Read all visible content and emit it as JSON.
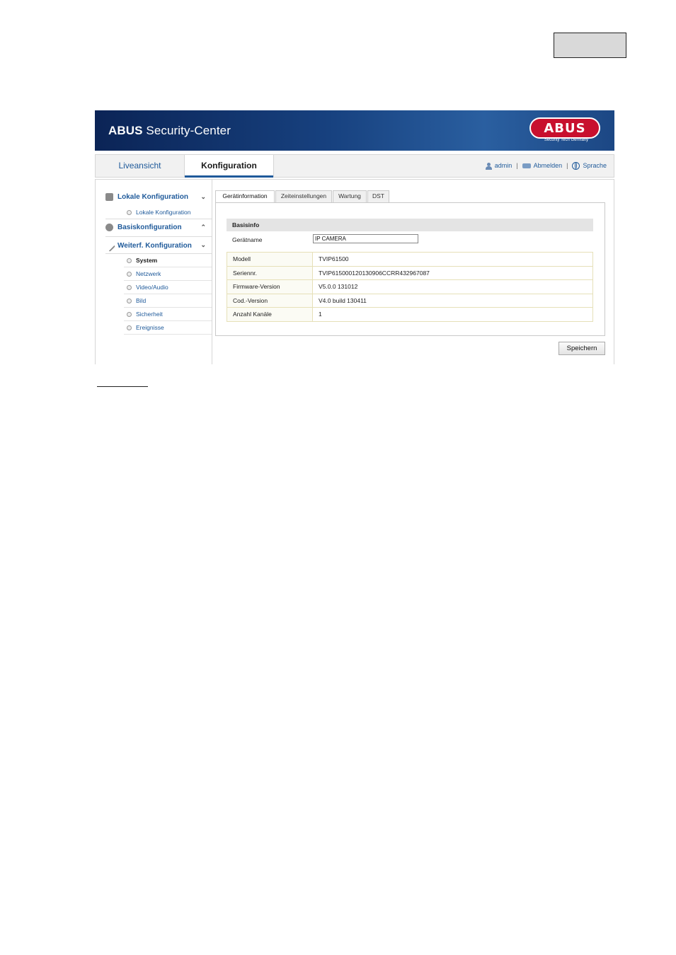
{
  "app": {
    "brand_bold": "ABUS",
    "brand_rest": " Security-Center",
    "logo_text": "ABUS",
    "logo_sub": "Security Tech Germany"
  },
  "nav": {
    "tabs": [
      {
        "label": "Liveansicht"
      },
      {
        "label": "Konfiguration",
        "active": true
      }
    ],
    "user": "admin",
    "logout": "Abmelden",
    "language": "Sprache"
  },
  "sidebar": {
    "sections": [
      {
        "label": "Lokale Konfiguration",
        "caret": "⌄",
        "icon": "monitor-icon",
        "items": [
          {
            "label": "Lokale Konfiguration"
          }
        ]
      },
      {
        "label": "Basiskonfiguration",
        "caret": "⌃",
        "icon": "gear-icon",
        "items": []
      },
      {
        "label": "Weiterf. Konfiguration",
        "caret": "⌄",
        "icon": "wrench-icon",
        "items": [
          {
            "label": "System",
            "active": true
          },
          {
            "label": "Netzwerk"
          },
          {
            "label": "Video/Audio"
          },
          {
            "label": "Bild"
          },
          {
            "label": "Sicherheit"
          },
          {
            "label": "Ereignisse"
          }
        ]
      }
    ]
  },
  "tabs": [
    {
      "label": "Gerätinformation",
      "active": true
    },
    {
      "label": "Zeiteinstellungen"
    },
    {
      "label": "Wartung"
    },
    {
      "label": "DST"
    }
  ],
  "basisinfo": {
    "title": "Basisinfo",
    "device_name_label": "Gerätname",
    "device_name_value": "IP CAMERA",
    "rows": [
      {
        "label": "Modell",
        "value": "TVIP61500"
      },
      {
        "label": "Seriennr.",
        "value": "TVIP615000120130906CCRR432967087"
      },
      {
        "label": "Firmware-Version",
        "value": "V5.0.0 131012"
      },
      {
        "label": "Cod.-Version",
        "value": "V4.0 build 130411"
      },
      {
        "label": "Anzahl Kanäle",
        "value": "1"
      }
    ]
  },
  "save_label": "Speichern",
  "colors": {
    "accent": "#1f5a9a",
    "banner": "#17417f",
    "logo": "#c8102e"
  }
}
